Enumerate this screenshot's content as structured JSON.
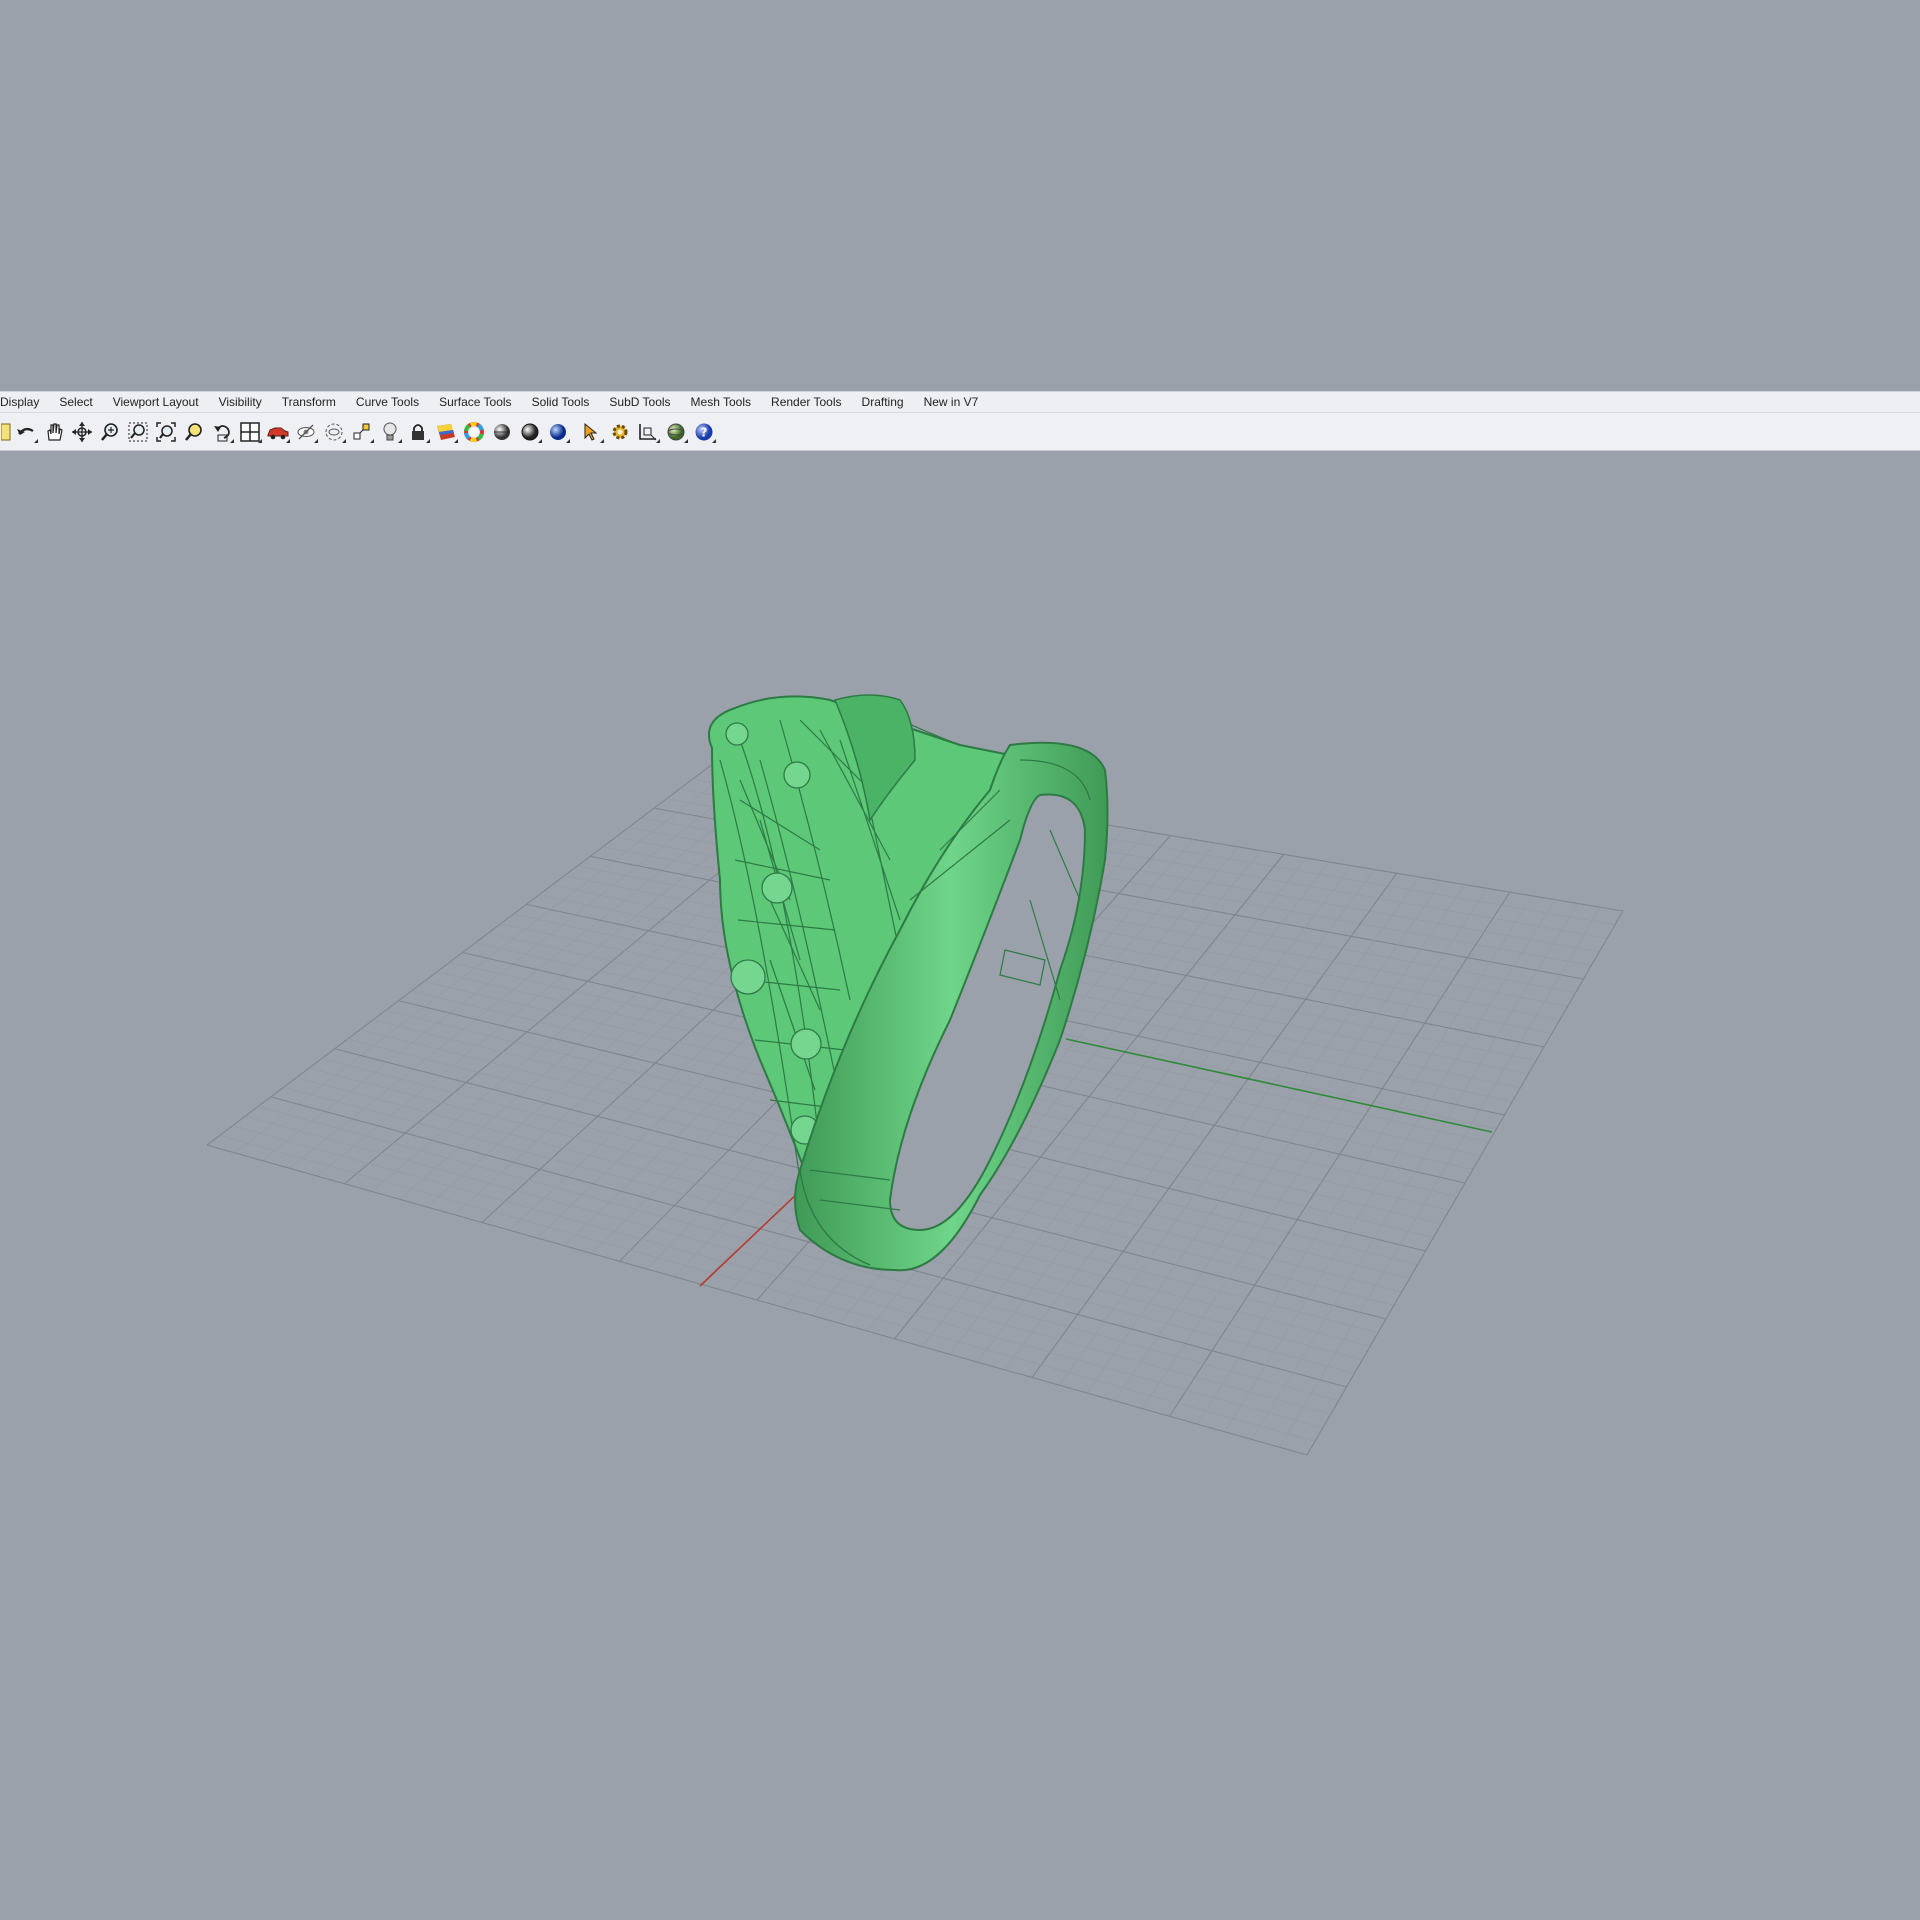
{
  "menu_tabs": [
    "Display",
    "Select",
    "Viewport Layout",
    "Visibility",
    "Transform",
    "Curve Tools",
    "Surface Tools",
    "Solid Tools",
    "SubD Tools",
    "Mesh Tools",
    "Render Tools",
    "Drafting",
    "New in V7"
  ],
  "toolbar_icons": [
    "new-file-icon",
    "undo-icon",
    "pan-hand-icon",
    "rotate-view-icon",
    "zoom-icon",
    "zoom-window-icon",
    "zoom-extents-icon",
    "zoom-selected-icon",
    "undo-view-icon",
    "four-viewports-icon",
    "car-named-view-icon",
    "hide-objects-icon",
    "show-objects-icon",
    "select-filter-icon",
    "light-bulb-icon",
    "lock-icon",
    "layer-color-icon",
    "color-wheel-icon",
    "shaded-sphere-icon",
    "rendered-sphere-icon",
    "blue-sphere-icon",
    "cursor-options-icon",
    "settings-gear-icon",
    "gumball-icon",
    "render-globe-icon",
    "help-icon"
  ],
  "colors": {
    "background": "#9ba1aa",
    "model": "#5cc878",
    "model_edge": "#2e7a45",
    "grid": "#8b9098",
    "x_axis": "#b23a2e",
    "y_axis": "#2f8a3a"
  }
}
